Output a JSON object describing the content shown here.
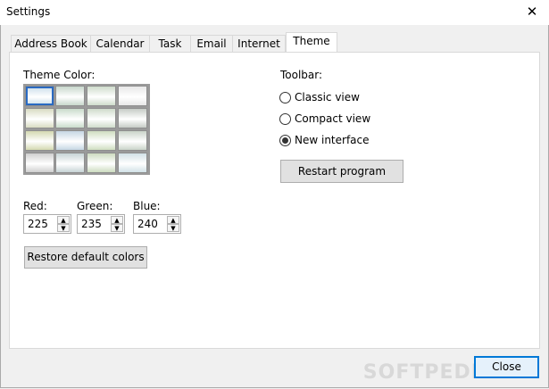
{
  "window": {
    "title": "Settings",
    "close_glyph": "✕"
  },
  "tabs": [
    {
      "label": "Address Book"
    },
    {
      "label": "Calendar"
    },
    {
      "label": "Task"
    },
    {
      "label": "Email"
    },
    {
      "label": "Internet"
    },
    {
      "label": "Theme",
      "active": true
    }
  ],
  "theme": {
    "color_label": "Theme Color:",
    "swatches": [
      [
        "#c9dde9",
        "#c8d8cc",
        "#cfddcc",
        "#e8e8e8"
      ],
      [
        "#d9dcc2",
        "#c9dccb",
        "#cfdccb",
        "#c6ccc6"
      ],
      [
        "#d4d9b1",
        "#c6d7e4",
        "#cfdec0",
        "#cad4c9"
      ],
      [
        "#cfcfcf",
        "#c7d4d6",
        "#cddcc0",
        "#d2e1e7"
      ]
    ],
    "selected_swatch": "0,0",
    "red": {
      "label": "Red:",
      "value": "225"
    },
    "green": {
      "label": "Green:",
      "value": "235"
    },
    "blue": {
      "label": "Blue:",
      "value": "240"
    },
    "restore_label": "Restore default colors"
  },
  "toolbar": {
    "label": "Toolbar:",
    "options": [
      {
        "label": "Classic view",
        "checked": false
      },
      {
        "label": "Compact view",
        "checked": false
      },
      {
        "label": "New interface",
        "checked": true
      }
    ],
    "restart_label": "Restart program"
  },
  "footer": {
    "close_label": "Close"
  },
  "watermark": "SOFTPEDIA"
}
